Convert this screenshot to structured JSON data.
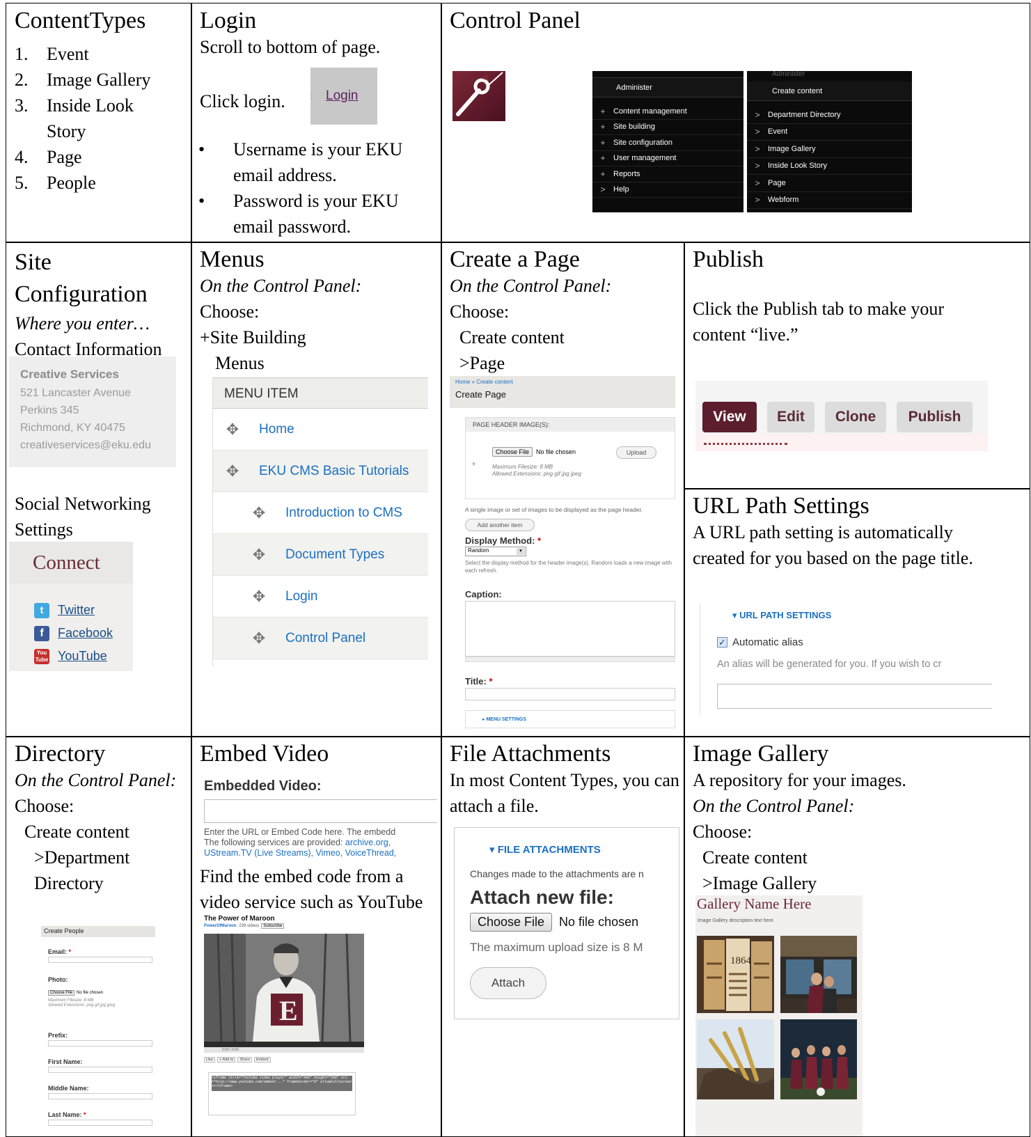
{
  "content_types": {
    "title": "ContentTypes",
    "items": [
      {
        "num": "1.",
        "label": "Event"
      },
      {
        "num": "2.",
        "label": "Image Gallery"
      },
      {
        "num": "3.",
        "label": "Inside Look Story"
      },
      {
        "num": "4.",
        "label": "Page"
      },
      {
        "num": "5.",
        "label": "People"
      }
    ]
  },
  "login": {
    "title": "Login",
    "line1": "Scroll to bottom of page.",
    "line2": "Click login.",
    "link": "Login",
    "bullets": [
      "Username is your EKU email address.",
      "Password is your EKU email password."
    ]
  },
  "control_panel": {
    "title": "Control Panel",
    "menu1_header": "Administer",
    "menu1": [
      {
        "glyph": "+",
        "label": "Content management"
      },
      {
        "glyph": "+",
        "label": "Site building"
      },
      {
        "glyph": "+",
        "label": "Site configuration"
      },
      {
        "glyph": "+",
        "label": "User management"
      },
      {
        "glyph": "+",
        "label": "Reports"
      },
      {
        "glyph": ">",
        "label": "Help"
      }
    ],
    "menu2_top": "Administer",
    "menu2_header": "Create content",
    "menu2": [
      "Department Directory",
      "Event",
      "Image Gallery",
      "Inside Look Story",
      "Page",
      "Webform"
    ]
  },
  "site_config": {
    "title": "Site Configuration",
    "where": "Where you enter…",
    "contact": "Contact Information",
    "card": {
      "name": "Creative Services",
      "lines": [
        "521 Lancaster Avenue",
        "Perkins 345",
        "Richmond, KY 40475",
        "creativeservices@eku.edu"
      ]
    },
    "social_label": "Social Networking Settings",
    "connect": "Connect",
    "social": [
      {
        "icon": "twitter-icon",
        "label": "Twitter",
        "color": "#3fa9e0"
      },
      {
        "icon": "facebook-icon",
        "label": "Facebook",
        "color": "#3b5998"
      },
      {
        "icon": "youtube-icon",
        "label": "YouTube",
        "color": "#c4302b"
      }
    ]
  },
  "menus": {
    "title": "Menus",
    "on_cp": "On the Control Panel:",
    "choose": "Choose:",
    "step1": "+Site Building",
    "step2": "Menus",
    "col_header": "MENU ITEM",
    "items": [
      "Home",
      "EKU CMS Basic Tutorials",
      "Introduction to CMS",
      "Document Types",
      "Login",
      "Control Panel"
    ]
  },
  "create_page": {
    "title": "Create a Page",
    "on_cp": "On the Control Panel:",
    "choose": "Choose:",
    "step1": "Create content",
    "step2": ">Page",
    "breadcrumb": "Home » Create content",
    "form_title": "Create Page",
    "header_images": "PAGE HEADER IMAGE(S):",
    "choose_file": "Choose File",
    "no_file": "No file chosen",
    "upload": "Upload",
    "max_size": "Maximum Filesize: 8 MB",
    "allowed": "Allowed Extensions: png gif jpg jpeg",
    "single_image": "A single image or set of images to be displayed as the page header.",
    "add_another": "Add another item",
    "display_method": "Display Method:",
    "random": "Random",
    "display_help": "Select the display method for the header image(s). Random loads a new image with each refresh.",
    "caption": "Caption:",
    "title_label": "Title:",
    "menu_settings": "▸ MENU SETTINGS"
  },
  "publish": {
    "title": "Publish",
    "text": "Click the Publish tab to make your content “live.”",
    "tabs": [
      "View",
      "Edit",
      "Clone",
      "Publish"
    ]
  },
  "url_path": {
    "title": "URL Path Settings",
    "text": "A URL path setting is automatically created for you based on the page title.",
    "section": "▾ URL PATH SETTINGS",
    "checkbox": "Automatic alias",
    "help": "An alias will be generated for you. If you wish to cr"
  },
  "directory": {
    "title": "Directory",
    "on_cp": "On the Control Panel:",
    "choose": "Choose:",
    "step1": "Create content",
    "step2": ">Department Directory",
    "form_title": "Create People",
    "fields": [
      "Email:",
      "Photo:",
      "Prefix:",
      "First Name:",
      "Middle Name:",
      "Last Name:"
    ],
    "choose_file": "Choose File",
    "no_file": "No file chosen",
    "max_size": "Maximum Filesize: 8 MB",
    "allowed": "Allowed Extensions: png gif jpg jpeg"
  },
  "embed": {
    "title": "Embed Video",
    "label": "Embedded Video:",
    "help1": "Enter the URL or Embed Code here. The embedd",
    "help2_prefix": "The following services are provided: ",
    "help2_links": "archive.org,",
    "help3": "UStream.TV (Live Streams), Vimeo, VoiceThread,",
    "find": "Find the embed code from a video service such as YouTube",
    "video_title": "The Power of Maroon",
    "channel": "PowerOfMaroon",
    "videos": "239 videos",
    "subscribe": "Subscribe",
    "time": "0:00 / 0:00",
    "letter": "E",
    "actions": [
      "Like",
      "+ Add to",
      "Share",
      "Embed"
    ],
    "code": "<iframe title=\"YouTube video player\" width=\"480\" height=\"390\" src=\"http://www.youtube.com/embed/...\" frameborder=\"0\" allowFullscreen></iframe>"
  },
  "file_att": {
    "title": "File Attachments",
    "text": "In most Content Types, you can attach a file.",
    "section": "▾ FILE ATTACHMENTS",
    "changes": "Changes made to the attachments are n",
    "attach_new": "Attach new file:",
    "choose_file": "Choose File",
    "no_file": "No file chosen",
    "max": "The maximum upload size is 8 M",
    "attach": "Attach"
  },
  "gallery": {
    "title": "Image Gallery",
    "text": "A repository for your images.",
    "on_cp": "On the Control Panel:",
    "choose": "Choose:",
    "step1": "Create content",
    "step2": ">Image Gallery",
    "gallery_name": "Gallery Name Here",
    "gallery_desc": "Image Gallery description text here.",
    "book_year": "1864"
  },
  "colors": {
    "maroon": "#5c1e2d",
    "link_blue": "#1b6fc2",
    "required": "#d00000"
  }
}
